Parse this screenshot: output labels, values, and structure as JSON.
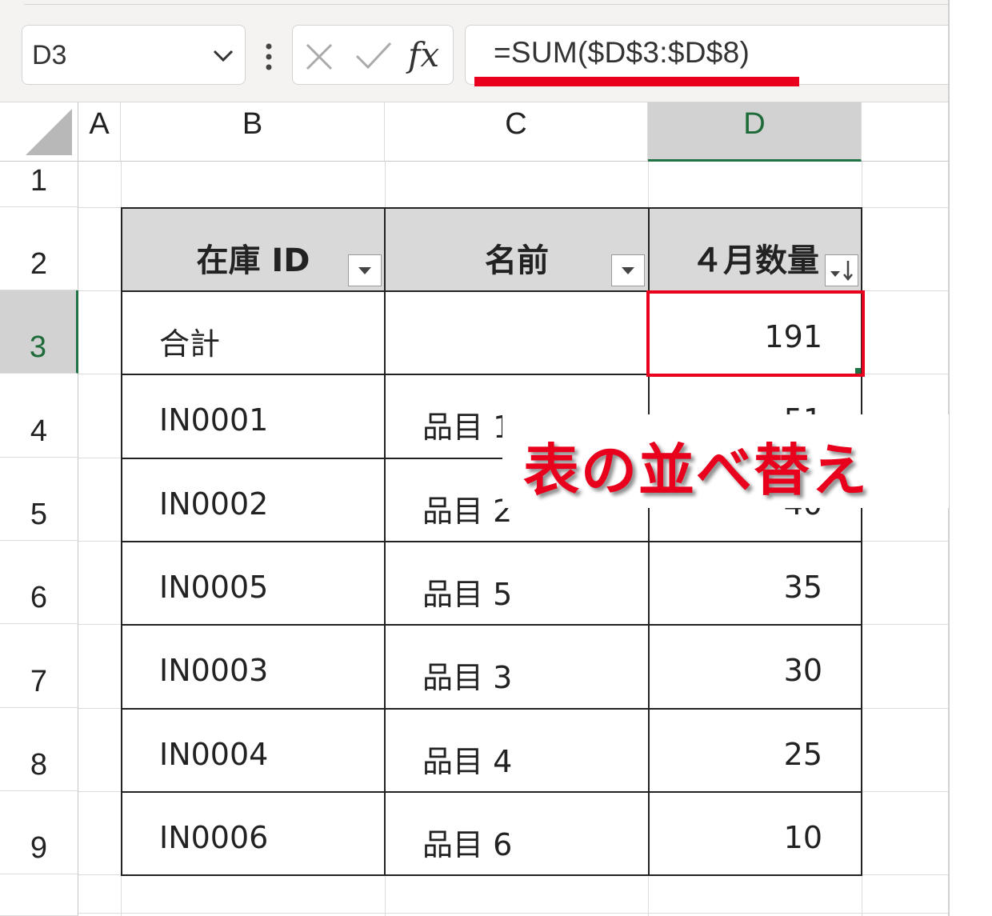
{
  "formula_bar": {
    "name_box": "D3",
    "cancel_icon": "close-icon",
    "enter_icon": "checkmark-icon",
    "fx_label": "fx",
    "formula": "=SUM($D$3:$D$8)"
  },
  "columns": [
    "A",
    "B",
    "C",
    "D"
  ],
  "selected_column": "D",
  "rows": [
    "1",
    "2",
    "3",
    "4",
    "5",
    "6",
    "7",
    "8",
    "9"
  ],
  "selected_row": "3",
  "table": {
    "headers": [
      "在庫 ID",
      "名前",
      "４月数量"
    ],
    "total_row": {
      "label": "合計",
      "name": "",
      "value": "191"
    },
    "rows": [
      {
        "id": "IN0001",
        "name": "品目 1",
        "qty": "51"
      },
      {
        "id": "IN0002",
        "name": "品目 2",
        "qty": "40"
      },
      {
        "id": "IN0005",
        "name": "品目 5",
        "qty": "35"
      },
      {
        "id": "IN0003",
        "name": "品目 3",
        "qty": "30"
      },
      {
        "id": "IN0004",
        "name": "品目 4",
        "qty": "25"
      },
      {
        "id": "IN0006",
        "name": "品目 6",
        "qty": "10"
      }
    ]
  },
  "annotation": "表の並べ替え",
  "colors": {
    "highlight": "#e8001c",
    "excel_green": "#217346",
    "header_fill": "#d9d9d9"
  }
}
